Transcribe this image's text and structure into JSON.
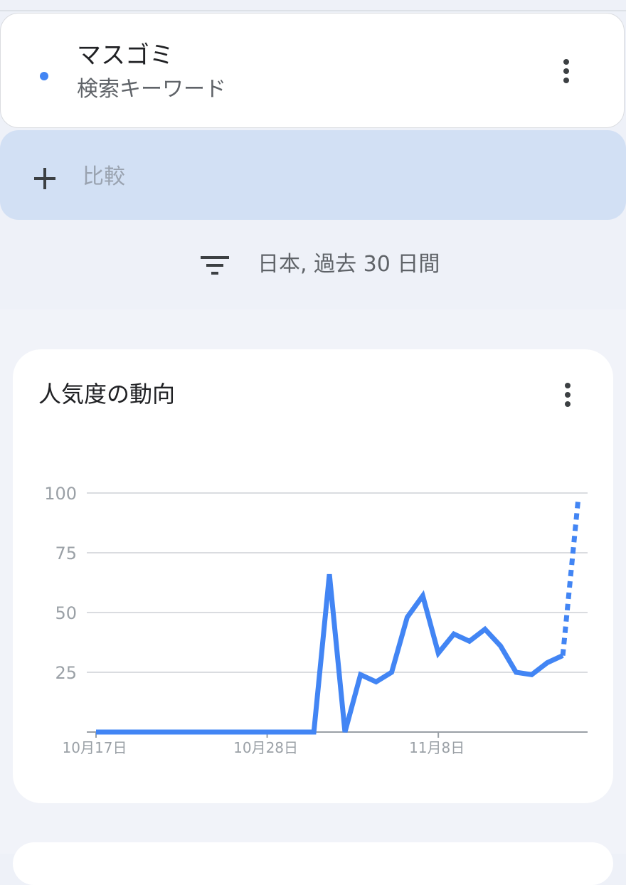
{
  "colors": {
    "accent": "#4285f4",
    "page_bg": "#eef1f8",
    "compare_bg": "#d2e0f4",
    "grid": "#dadce0",
    "axis_text": "#9aa0a6"
  },
  "term": {
    "name": "マスゴミ",
    "type": "検索キーワード",
    "dot_color": "#4285f4",
    "menu_icon": "more-vert-icon"
  },
  "compare": {
    "icon": "plus-icon",
    "label": "比較"
  },
  "filter": {
    "icon": "filter-icon",
    "label": "日本, 過去 30 日間"
  },
  "chart_card": {
    "title": "人気度の動向",
    "menu_icon": "more-vert-icon"
  },
  "chart_data": {
    "type": "line",
    "title": "",
    "xlabel": "",
    "ylabel": "",
    "ylim": [
      0,
      100
    ],
    "y_ticks": [
      "100",
      "75",
      "50",
      "25"
    ],
    "x_ticks": [
      {
        "index": 0,
        "label": "10月17日"
      },
      {
        "index": 11,
        "label": "10月28日"
      },
      {
        "index": 22,
        "label": "11月8日"
      }
    ],
    "grid": true,
    "legend": "none",
    "x": [
      "10月17日",
      "10月18日",
      "10月19日",
      "10月20日",
      "10月21日",
      "10月22日",
      "10月23日",
      "10月24日",
      "10月25日",
      "10月26日",
      "10月27日",
      "10月28日",
      "10月29日",
      "10月30日",
      "10月31日",
      "11月1日",
      "11月2日",
      "11月3日",
      "11月4日",
      "11月5日",
      "11月6日",
      "11月7日",
      "11月8日",
      "11月9日",
      "11月10日",
      "11月11日",
      "11月12日",
      "11月13日",
      "11月14日",
      "11月15日",
      "11月16日",
      "11月17日"
    ],
    "series": [
      {
        "color": "#4285f4",
        "values": [
          0,
          0,
          0,
          0,
          0,
          0,
          0,
          0,
          0,
          0,
          0,
          0,
          0,
          0,
          0,
          66,
          0,
          24,
          21,
          25,
          48,
          57,
          33,
          41,
          38,
          43,
          36,
          25,
          24,
          29,
          32,
          98
        ],
        "partial_from_index": 30
      }
    ]
  }
}
